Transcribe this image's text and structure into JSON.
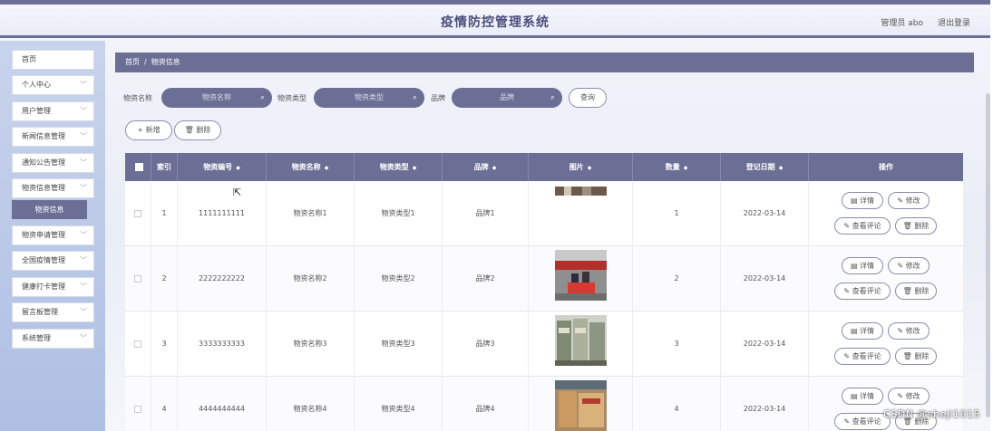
{
  "header": {
    "title": "疫情防控管理系统",
    "admin_text": "管理员 abo",
    "logout_label": "退出登录"
  },
  "sidebar": {
    "items": [
      {
        "label": "首页",
        "has_chevron": false
      },
      {
        "label": "个人中心",
        "has_chevron": true
      },
      {
        "label": "用户管理",
        "has_chevron": true
      },
      {
        "label": "新闻信息管理",
        "has_chevron": true
      },
      {
        "label": "通知公告管理",
        "has_chevron": true
      },
      {
        "label": "物资信息管理",
        "has_chevron": true
      },
      {
        "label": "物资申请管理",
        "has_chevron": true
      },
      {
        "label": "全国疫情管理",
        "has_chevron": true
      },
      {
        "label": "健康打卡管理",
        "has_chevron": true
      },
      {
        "label": "留言板管理",
        "has_chevron": true
      },
      {
        "label": "系统管理",
        "has_chevron": true
      }
    ],
    "active_sub_item": "物资信息"
  },
  "breadcrumb": {
    "home": "首页",
    "separator": "/",
    "current": "物资信息"
  },
  "search": {
    "name_label": "物资名称",
    "name_placeholder": "物资名称",
    "type_label": "物资类型",
    "type_placeholder": "物资类型",
    "brand_label": "品牌",
    "brand_placeholder": "品牌",
    "query_label": "查询"
  },
  "actions": {
    "add_label": "+ 新增",
    "delete_label": "删除"
  },
  "table": {
    "columns": [
      "索引",
      "物资编号",
      "物资名称",
      "物资类型",
      "品牌",
      "图片",
      "数量",
      "登记日期",
      "操作"
    ],
    "rows": [
      {
        "index": "1",
        "code": "1111111111",
        "name": "物资名称1",
        "type": "物资类型1",
        "brand": "品牌1",
        "qty": "1",
        "date": "2022-03-14"
      },
      {
        "index": "2",
        "code": "2222222222",
        "name": "物资名称2",
        "type": "物资类型2",
        "brand": "品牌2",
        "qty": "2",
        "date": "2022-03-14"
      },
      {
        "index": "3",
        "code": "3333333333",
        "name": "物资名称3",
        "type": "物资类型3",
        "brand": "品牌3",
        "qty": "3",
        "date": "2022-03-14"
      },
      {
        "index": "4",
        "code": "4444444444",
        "name": "物资名称4",
        "type": "物资类型4",
        "brand": "品牌4",
        "qty": "4",
        "date": "2022-03-14"
      }
    ],
    "row_actions": {
      "detail": "详情",
      "edit": "修改",
      "comments": "查看评论",
      "delete": "删除"
    }
  },
  "watermark": "CSDN @sheji1015",
  "colors": {
    "accent": "#6c6f95",
    "sidebar_bg": "#aebfe3"
  }
}
